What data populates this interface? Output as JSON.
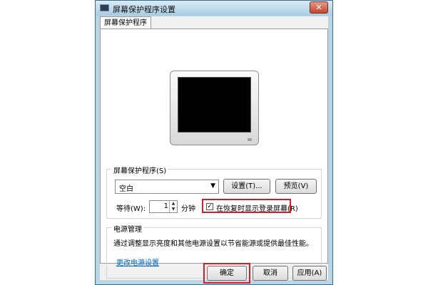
{
  "window": {
    "title": "屏幕保护程序设置",
    "close_label": "✕"
  },
  "tab": {
    "label": "屏幕保护程序"
  },
  "screensaver": {
    "group_label": "屏幕保护程序(S)",
    "selected": "空白",
    "settings_button": "设置(T)...",
    "preview_button": "预览(V)",
    "wait_label": "等待(W):",
    "wait_value": "1",
    "wait_unit": "分钟",
    "resume_checkbox_label": "在恢复时显示登录屏幕(R)",
    "resume_checked": true
  },
  "power": {
    "group_label": "电源管理",
    "description": "通过调整显示亮度和其他电源设置以节省能源或提供最佳性能。",
    "link_text": "更改电源设置"
  },
  "footer": {
    "ok_button": "确定",
    "cancel_button": "取消",
    "apply_button": "应用(A)"
  },
  "colors": {
    "highlight": "#d0202a",
    "link": "#0066cc"
  }
}
